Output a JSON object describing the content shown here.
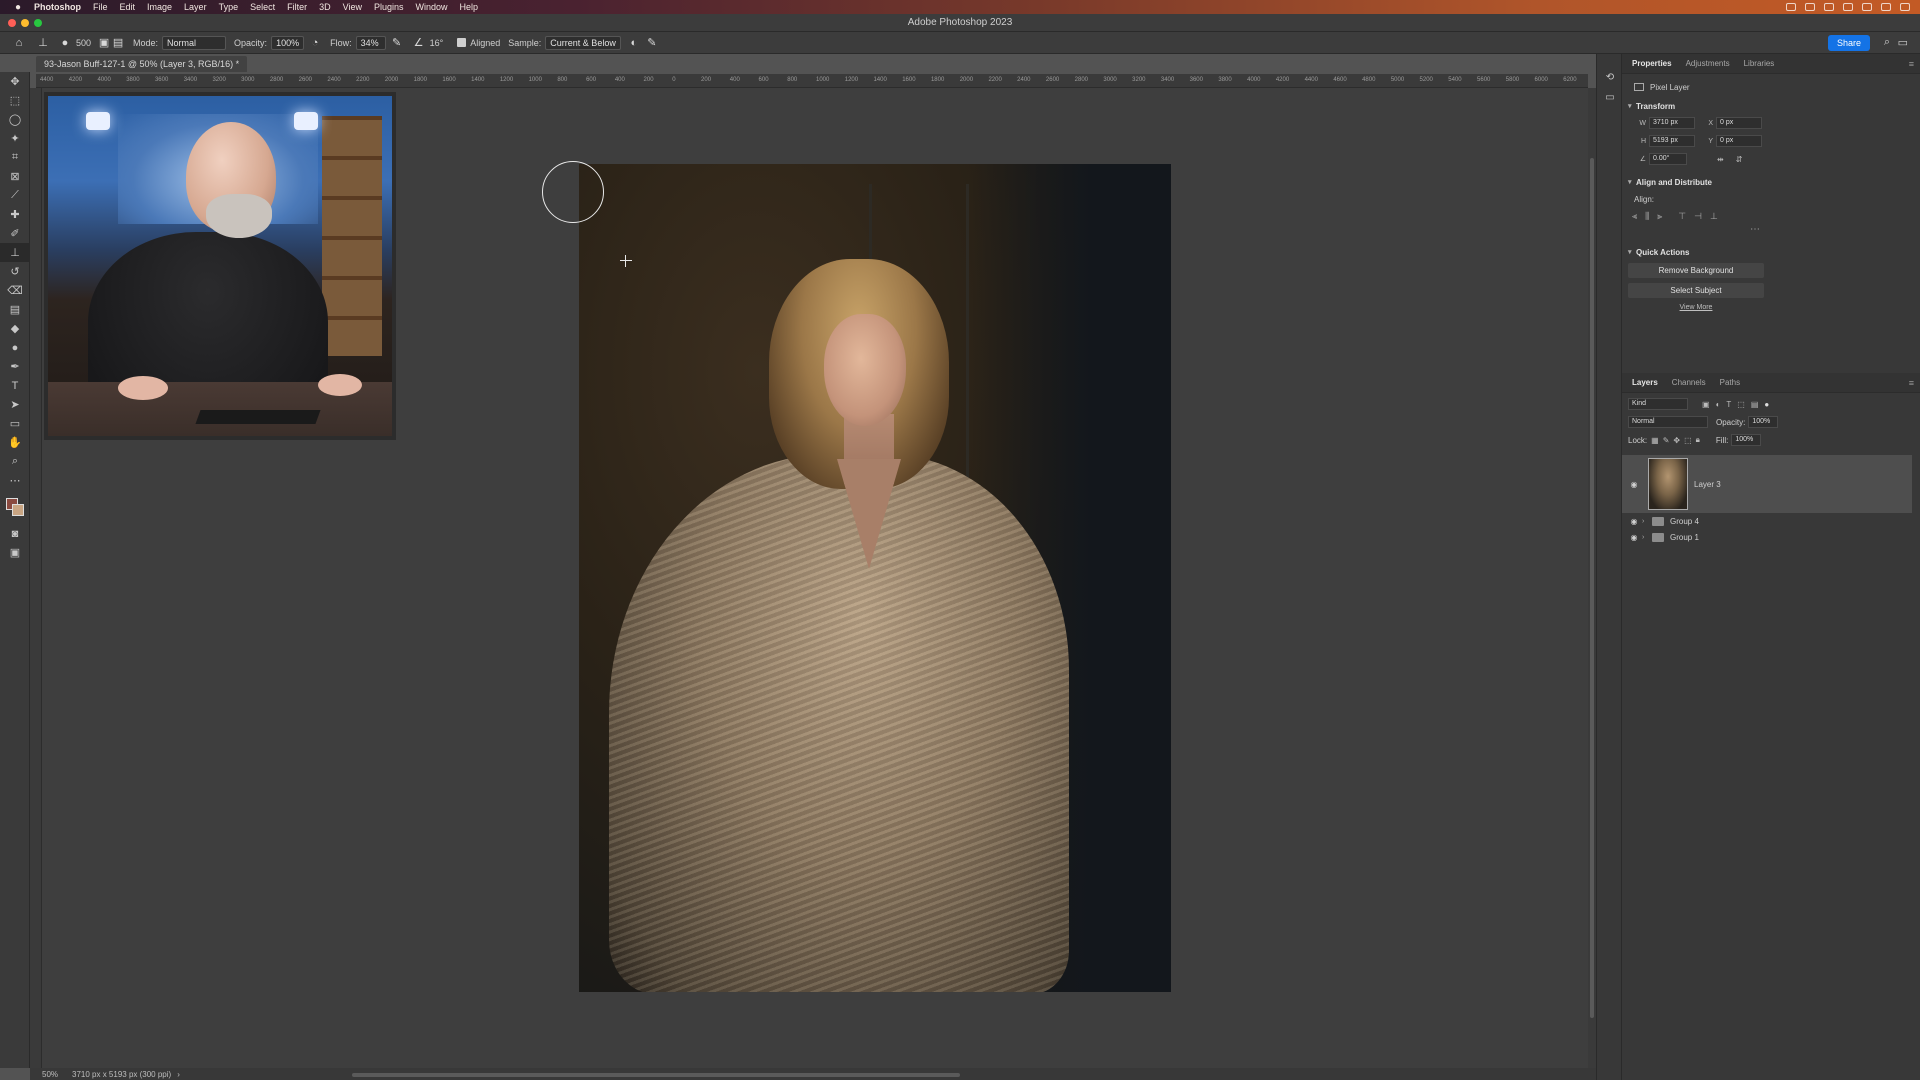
{
  "menubar": {
    "app_name": "Photoshop",
    "items": [
      "File",
      "Edit",
      "Image",
      "Layer",
      "Type",
      "Select",
      "Filter",
      "3D",
      "View",
      "Plugins",
      "Window",
      "Help"
    ]
  },
  "window": {
    "title": "Adobe Photoshop 2023"
  },
  "options_bar": {
    "brush_size": "500",
    "mode_label": "Mode:",
    "mode_value": "Normal",
    "opacity_label": "Opacity:",
    "opacity_value": "100%",
    "flow_label": "Flow:",
    "flow_value": "34%",
    "angle_value": "16°",
    "aligned_label": "Aligned",
    "sample_label": "Sample:",
    "sample_value": "Current & Below",
    "share_label": "Share"
  },
  "document": {
    "tab_title": "93-Jason Buff-127-1 @ 50% (Layer 3, RGB/16) *",
    "zoom": "50%",
    "doc_size": "3710 px x 5193 px (300 ppi)"
  },
  "ruler": {
    "ticks": [
      "4400",
      "4200",
      "4000",
      "3800",
      "3600",
      "3400",
      "3200",
      "3000",
      "2800",
      "2600",
      "2400",
      "2200",
      "2000",
      "1800",
      "1600",
      "1400",
      "1200",
      "1000",
      "800",
      "600",
      "400",
      "200",
      "0",
      "200",
      "400",
      "600",
      "800",
      "1000",
      "1200",
      "1400",
      "1600",
      "1800",
      "2000",
      "2200",
      "2400",
      "2600",
      "2800",
      "3000",
      "3200",
      "3400",
      "3600",
      "3800",
      "4000",
      "4200",
      "4400",
      "4600",
      "4800",
      "5000",
      "5200",
      "5400",
      "5600",
      "5800",
      "6000",
      "6200"
    ]
  },
  "properties_panel": {
    "tabs": [
      "Properties",
      "Adjustments",
      "Libraries"
    ],
    "layer_kind": "Pixel Layer",
    "transform_title": "Transform",
    "w_label": "W",
    "w_value": "3710 px",
    "h_label": "H",
    "h_value": "5193 px",
    "x_label": "X",
    "x_value": "0 px",
    "y_label": "Y",
    "y_value": "0 px",
    "angle_value": "0.00°",
    "align_title": "Align and Distribute",
    "align_label": "Align:",
    "quick_actions_title": "Quick Actions",
    "remove_background": "Remove Background",
    "select_subject": "Select Subject",
    "view_more": "View More"
  },
  "layers_panel": {
    "tabs": [
      "Layers",
      "Channels",
      "Paths"
    ],
    "filter_kind": "Kind",
    "blend_mode": "Normal",
    "opacity_label": "Opacity:",
    "opacity_value": "100%",
    "lock_label": "Lock:",
    "fill_label": "Fill:",
    "fill_value": "100%",
    "layers": [
      {
        "name": "Layer 3",
        "type": "pixel",
        "selected": true
      },
      {
        "name": "Group 4",
        "type": "group",
        "selected": false
      },
      {
        "name": "Group 1",
        "type": "group",
        "selected": false
      }
    ]
  },
  "colors": {
    "accent": "#1473e6",
    "foreground_swatch": "#8a4a40",
    "background_swatch": "#c9a583"
  }
}
